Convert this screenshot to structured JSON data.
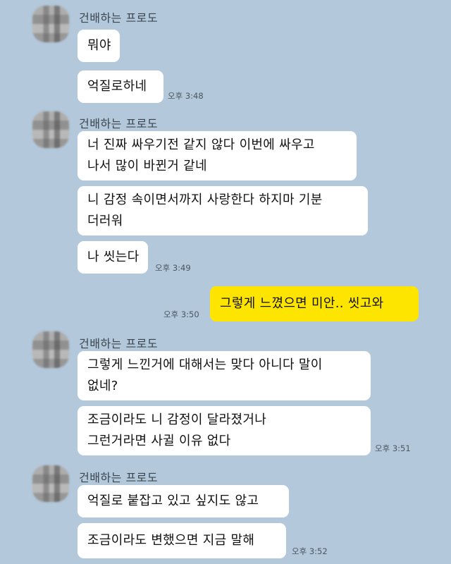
{
  "messages": {
    "g1": {
      "sender": "건배하는 프로도",
      "b1": "뭐야",
      "b2": "억질로하네",
      "time": "오후 3:48"
    },
    "g2": {
      "sender": "건배하는 프로도",
      "b1_l1": "너 진짜 싸우기전 같지 않다 이번에 싸우고",
      "b1_l2": "나서 많이 바뀐거 같네",
      "b2_l1": "니 감정 속이면서까지 사랑한다 하지마 기분",
      "b2_l2": "더러워",
      "b3": "나 씻는다",
      "time": "오후 3:49"
    },
    "mine": {
      "text": "그렇게 느꼈으면 미안.. 씻고와",
      "time": "오후 3:50"
    },
    "g3": {
      "sender": "건배하는 프로도",
      "b1_l1": "그렇게 느낀거에 대해서는 맞다 아니다 말이",
      "b1_l2": "없네?",
      "b2_l1": "조금이라도 니 감정이 달라졌거나",
      "b2_l2": "그런거라면 사귈 이유 없다",
      "time": "오후 3:51"
    },
    "g4": {
      "sender": "건배하는 프로도",
      "b1": "억질로 붙잡고 있고 싶지도 않고",
      "b2": "조금이라도 변했으면 지금 말해",
      "time": "오후 3:52"
    }
  }
}
